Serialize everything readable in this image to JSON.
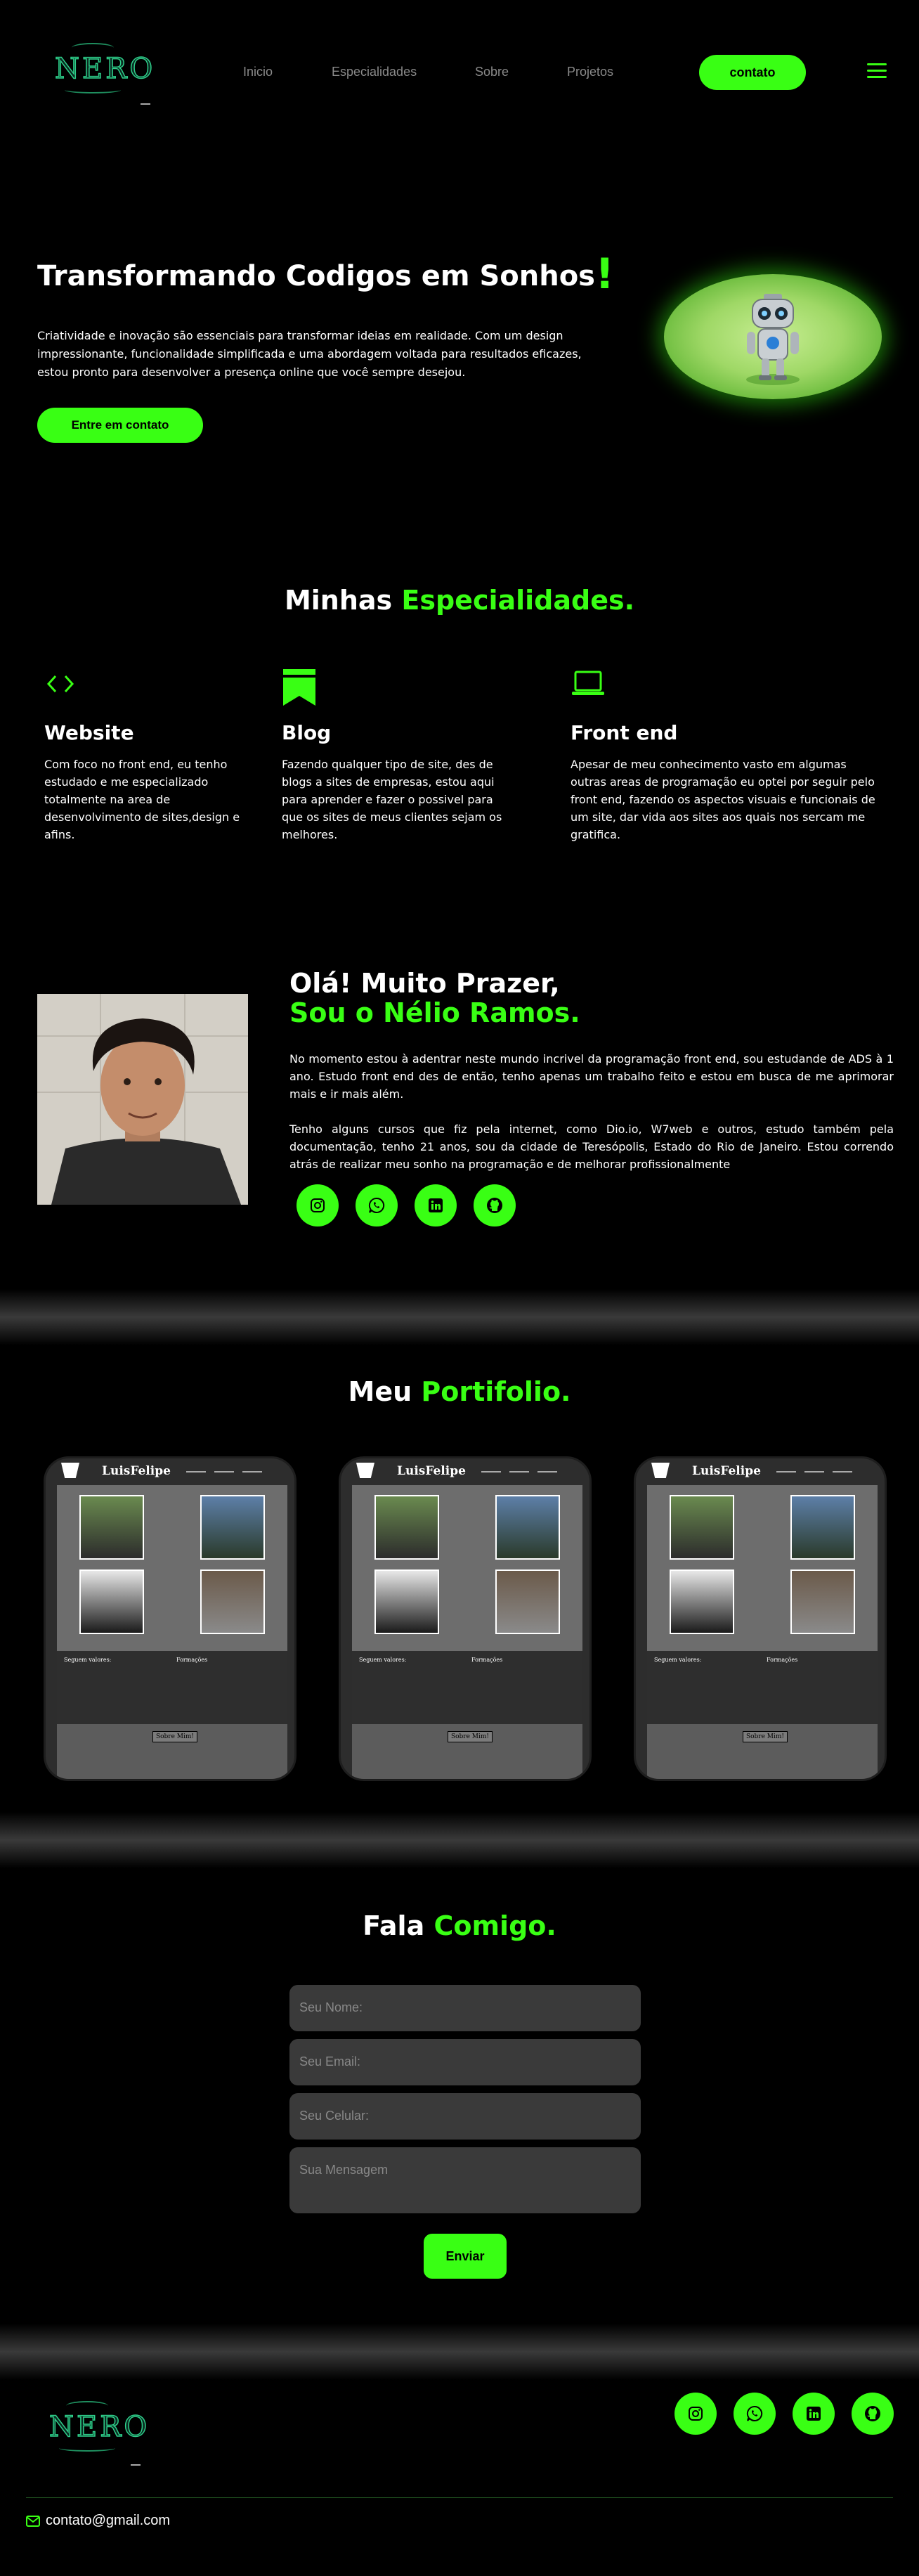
{
  "header": {
    "logo_text": "NERO",
    "nav": [
      "Inicio",
      "Especialidades",
      "Sobre",
      "Projetos"
    ],
    "contact_label": "contato"
  },
  "hero": {
    "title": "Transformando Codigos em Sonhos",
    "title_mark": "!",
    "text": "Criatividade e inovação são essenciais para transformar ideias em realidade. Com um design impressionante, funcionalidade simplificada e uma abordagem voltada para resultados eficazes, estou pronto para desenvolver a presença online que você sempre desejou.",
    "button": "Entre em contato"
  },
  "specialties": {
    "title_plain": "Minhas",
    "title_green": "Especialidades.",
    "items": [
      {
        "icon": "code-icon",
        "title": "Website",
        "text": "Com foco no front end, eu tenho estudado e me especializado totalmente na area de desenvolvimento de sites,design e afins."
      },
      {
        "icon": "bookmark-icon",
        "title": "Blog",
        "text": "Fazendo qualquer tipo de site, des de blogs a sites de empresas, estou aqui para aprender e fazer o possivel para que os sites de meus clientes sejam os melhores."
      },
      {
        "icon": "laptop-icon",
        "title": "Front end",
        "text": "Apesar de meu conhecimento vasto em algumas outras areas de programação eu optei por seguir pelo front end, fazendo os aspectos visuais e funcionais de um site, dar vida aos sites aos quais nos sercam me gratifica."
      }
    ]
  },
  "about": {
    "greeting": "Olá! Muito Prazer,",
    "name_line": "Sou o Nélio Ramos.",
    "p1": "No momento estou à adentrar neste mundo incrivel da programação front end, sou estudande de ADS à 1 ano. Estudo front end des de então, tenho apenas um trabalho feito e estou em busca de me aprimorar mais e ir mais além.",
    "p2": "Tenho alguns cursos que fiz pela internet, como Dio.io, W7web e outros, estudo também pela documentação, tenho 21 anos, sou da cidade de Teresópolis, Estado do Rio de Janeiro. Estou correndo atrás de realizar meu sonho na programação e de melhorar profissionalmente"
  },
  "portfolio": {
    "title_plain": "Meu",
    "title_green": "Portifolio.",
    "card_title": "LuisFelipe",
    "card_button": "Sobre Mim!",
    "card_left_heading": "Seguem valores:",
    "card_right_heading": "Formações"
  },
  "contact": {
    "title_plain": "Fala",
    "title_green": "Comigo.",
    "name_placeholder": "Seu Nome:",
    "email_placeholder": "Seu Email:",
    "phone_placeholder": "Seu Celular:",
    "message_placeholder": "Sua Mensagem",
    "send": "Enviar"
  },
  "footer": {
    "logo_text": "NERO",
    "email": "contato@gmail.com"
  },
  "colors": {
    "accent": "#39ff14",
    "background": "#000000",
    "field": "#3a3a3a"
  }
}
